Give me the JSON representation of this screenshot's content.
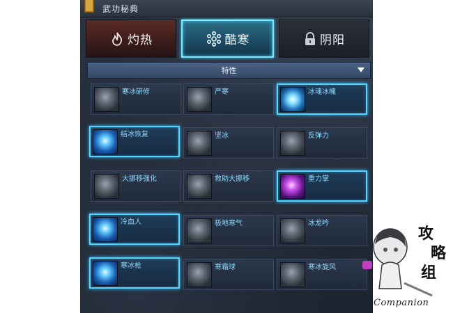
{
  "window": {
    "title": "武功秘典"
  },
  "tabs": [
    {
      "label": "灼热",
      "icon": "flame-icon",
      "selected": false
    },
    {
      "label": "酷寒",
      "icon": "snowflake-icon",
      "selected": true
    },
    {
      "label": "阴阳",
      "icon": "lock-icon",
      "selected": false
    }
  ],
  "filter": {
    "selected": "特性"
  },
  "skills": [
    {
      "name": "寒冰研修",
      "active": false
    },
    {
      "name": "严寒",
      "active": false
    },
    {
      "name": "冰魂冰魄",
      "active": true
    },
    {
      "name": "结冰恢复",
      "active": true
    },
    {
      "name": "坚冰",
      "active": false
    },
    {
      "name": "反弹力",
      "active": false
    },
    {
      "name": "大挪移强化",
      "active": false
    },
    {
      "name": "救助大挪移",
      "active": false
    },
    {
      "name": "重力掌",
      "active": true
    },
    {
      "name": "冷血人",
      "active": true
    },
    {
      "name": "极地寒气",
      "active": false
    },
    {
      "name": "冰龙吟",
      "active": false
    },
    {
      "name": "寒冰枪",
      "active": true
    },
    {
      "name": "寒霜球",
      "active": false
    },
    {
      "name": "寒冰旋风",
      "active": false
    }
  ],
  "watermark": {
    "text": "Companion",
    "characters": [
      "攻",
      "略",
      "组"
    ]
  },
  "colors": {
    "accent": "#56d6ff",
    "label": "#8fd9ff",
    "panel": "#222a37"
  }
}
